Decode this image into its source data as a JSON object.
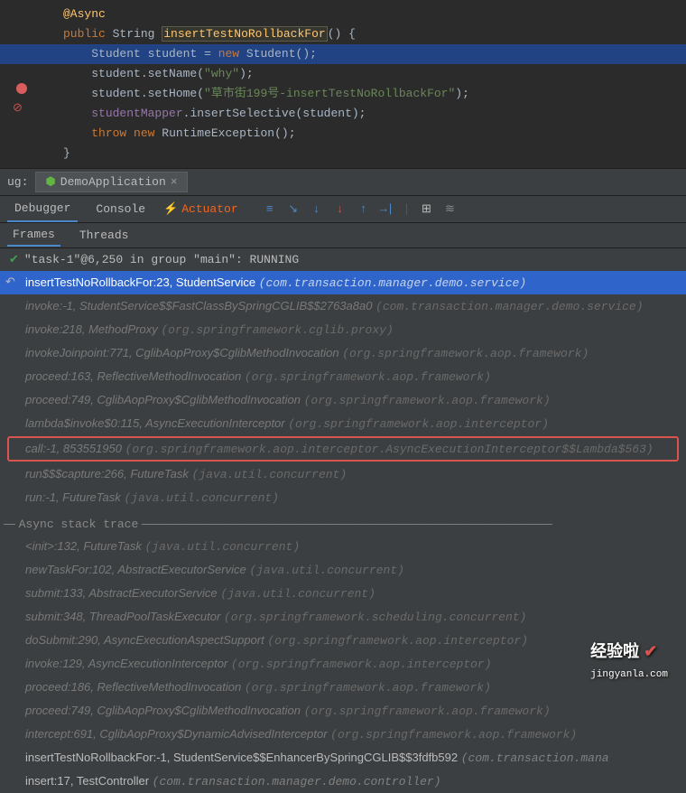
{
  "editor": {
    "annotation": "@Async",
    "modifiers": "public",
    "returnType": "String",
    "methodName": "insertTestNoRollbackFor",
    "line2_p1": "Student",
    "line2_p2": "student",
    "line2_p3": "=",
    "line2_new": "new",
    "line2_ctor": "Student",
    "line3_obj": "student",
    "line3_method": ".setName(",
    "line3_arg": "\"why\"",
    "line4_obj": "student",
    "line4_method": ".setHome(",
    "line4_arg": "\"草市街199号-insertTestNoRollbackFor\"",
    "line5_obj": "studentMapper",
    "line5_method": ".insertSelective(",
    "line5_arg": "student",
    "line6_throw": "throw",
    "line6_new": "new",
    "line6_ex": "RuntimeException"
  },
  "debug": {
    "label": "ug:",
    "appName": "DemoApplication",
    "tab_debugger": "Debugger",
    "tab_console": "Console",
    "tab_actuator": "Actuator",
    "tab_frames": "Frames",
    "tab_threads": "Threads",
    "status": "\"task-1\"@6,250 in group \"main\": RUNNING",
    "section_async": "Async stack trace"
  },
  "frames": [
    {
      "text": "insertTestNoRollbackFor:23, StudentService",
      "pkg": "(com.transaction.manager.demo.service)",
      "selected": true
    },
    {
      "text": "invoke:-1, StudentService$$FastClassBySpringCGLIB$$2763a8a0",
      "pkg": "(com.transaction.manager.demo.service)"
    },
    {
      "text": "invoke:218, MethodProxy",
      "pkg": "(org.springframework.cglib.proxy)"
    },
    {
      "text": "invokeJoinpoint:771, CglibAopProxy$CglibMethodInvocation",
      "pkg": "(org.springframework.aop.framework)"
    },
    {
      "text": "proceed:163, ReflectiveMethodInvocation",
      "pkg": "(org.springframework.aop.framework)"
    },
    {
      "text": "proceed:749, CglibAopProxy$CglibMethodInvocation",
      "pkg": "(org.springframework.aop.framework)"
    },
    {
      "text": "lambda$invoke$0:115, AsyncExecutionInterceptor",
      "pkg": "(org.springframework.aop.interceptor)"
    },
    {
      "text": "call:-1, 853551950",
      "pkg": "(org.springframework.aop.interceptor.AsyncExecutionInterceptor$$Lambda$563)",
      "boxed": true
    },
    {
      "text": "run$$$capture:266, FutureTask",
      "pkg": "(java.util.concurrent)"
    },
    {
      "text": "run:-1, FutureTask",
      "pkg": "(java.util.concurrent)"
    }
  ],
  "async_frames": [
    {
      "text": "<init>:132, FutureTask",
      "pkg": "(java.util.concurrent)"
    },
    {
      "text": "newTaskFor:102, AbstractExecutorService",
      "pkg": "(java.util.concurrent)"
    },
    {
      "text": "submit:133, AbstractExecutorService",
      "pkg": "(java.util.concurrent)"
    },
    {
      "text": "submit:348, ThreadPoolTaskExecutor",
      "pkg": "(org.springframework.scheduling.concurrent)"
    },
    {
      "text": "doSubmit:290, AsyncExecutionAspectSupport",
      "pkg": "(org.springframework.aop.interceptor)"
    },
    {
      "text": "invoke:129, AsyncExecutionInterceptor",
      "pkg": "(org.springframework.aop.interceptor)"
    },
    {
      "text": "proceed:186, ReflectiveMethodInvocation",
      "pkg": "(org.springframework.aop.framework)"
    },
    {
      "text": "proceed:749, CglibAopProxy$CglibMethodInvocation",
      "pkg": "(org.springframework.aop.framework)"
    },
    {
      "text": "intercept:691, CglibAopProxy$DynamicAdvisedInterceptor",
      "pkg": "(org.springframework.aop.framework)"
    },
    {
      "text": "insertTestNoRollbackFor:-1, StudentService$$EnhancerBySpringCGLIB$$3fdfb592",
      "pkg": "(com.transaction.mana",
      "white": true
    },
    {
      "text": "insert:17, TestController",
      "pkg": "(com.transaction.manager.demo.controller)",
      "white": true
    }
  ],
  "watermark": {
    "title": "经验啦",
    "sub": "jingyanla.com"
  }
}
